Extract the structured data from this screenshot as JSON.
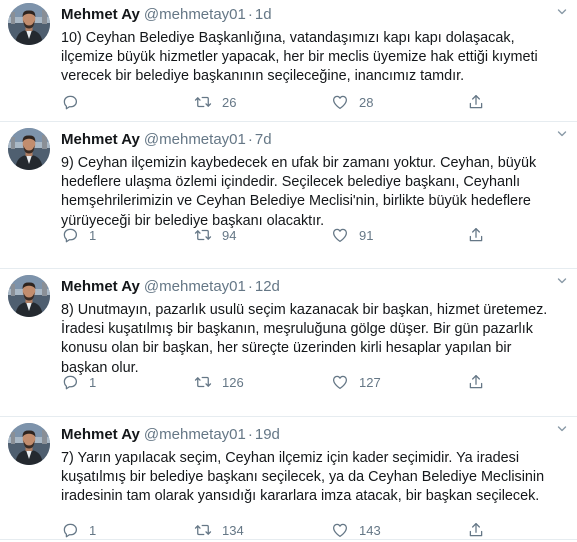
{
  "tweets": [
    {
      "name": "Mehmet Ay",
      "handle": "@mehmetay01",
      "separator": "·",
      "time": "1d",
      "lines": [
        "10) Ceyhan Belediye Başkanlığına, vatandaşımızı kapı kapı dolaşacak,",
        "ilçemize büyük hizmetler yapacak, her bir meclis üyemize hak ettiği kıymeti",
        "verecek bir belediye başkanının seçileceğine, inancımız tamdır."
      ],
      "replies": "",
      "retweets": "26",
      "likes": "28"
    },
    {
      "name": "Mehmet Ay",
      "handle": "@mehmetay01",
      "separator": "·",
      "time": "7d",
      "lines": [
        "9) Ceyhan ilçemizin kaybedecek en ufak bir zamanı yoktur. Ceyhan, büyük",
        "hedeflere ulaşma özlemi içindedir. Seçilecek belediye başkanı, Ceyhanlı",
        "hemşehrilerimizin ve Ceyhan Belediye Meclisi'nin, birlikte büyük hedeflere",
        "yürüyeceği bir belediye başkanı olacaktır."
      ],
      "replies": "1",
      "retweets": "94",
      "likes": "91"
    },
    {
      "name": "Mehmet Ay",
      "handle": "@mehmetay01",
      "separator": "·",
      "time": "12d",
      "lines": [
        "8) Unutmayın, pazarlık usulü seçim kazanacak bir başkan, hizmet üretemez.",
        "İradesi kuşatılmış bir başkanın, meşruluğuna gölge düşer. Bir gün pazarlık",
        "konusu olan bir başkan, her süreçte üzerinden kirli hesaplar yapılan bir",
        "başkan olur."
      ],
      "replies": "1",
      "retweets": "126",
      "likes": "127"
    },
    {
      "name": "Mehmet Ay",
      "handle": "@mehmetay01",
      "separator": "·",
      "time": "19d",
      "lines": [
        "7) Yarın yapılacak seçim, Ceyhan ilçemiz için kader seçimidir. Ya iradesi",
        "kuşatılmış bir belediye başkanı seçilecek, ya da Ceyhan Belediye Meclisinin",
        "iradesinin tam olarak yansıdığı kararlara imza atacak, bir başkan seçilecek."
      ],
      "replies": "1",
      "retweets": "134",
      "likes": "143"
    }
  ],
  "icons": {
    "reply": "reply-icon",
    "retweet": "retweet-icon",
    "like": "like-icon",
    "share": "share-icon",
    "more": "chevron-down-icon"
  },
  "colors": {
    "text": "#14171a",
    "secondary": "#657786",
    "divider": "#e6ecf0"
  }
}
